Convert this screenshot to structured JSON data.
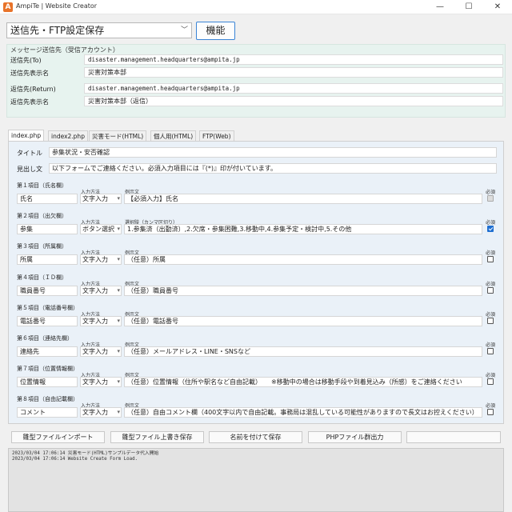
{
  "window": {
    "title": "AmpiTe | Website Creator",
    "app_icon": "A",
    "minimize": "—",
    "maximize": "☐",
    "close": "✕"
  },
  "toolbar": {
    "mode_value": "送信先・FTP設定保存",
    "function_label": "機能"
  },
  "message_panel": {
    "title": "メッセージ送信先（受信アカウント）",
    "rows": [
      {
        "label": "送信先(To)",
        "value": "disaster.management.headquarters@ampita.jp"
      },
      {
        "label": "送信先表示名",
        "value": "災害対策本部"
      },
      {
        "label": "返信先(Return)",
        "value": "disaster.management.headquarters@ampita.jp"
      },
      {
        "label": "返信先表示名",
        "value": "災害対策本部（返信）"
      }
    ]
  },
  "tabs": [
    "index.php",
    "index2.php",
    "災害モード(HTML)",
    "個人用(HTML)",
    "FTP(Web)"
  ],
  "form": {
    "title_label": "タイトル",
    "title_value": "参集状況・安否確認",
    "heading_label": "見出し文",
    "heading_value": "以下フォームでご連絡ください。必須入力項目には『(*)』印が付いています。",
    "col_input_method": "入力方法",
    "col_example": "例示文",
    "col_options": "選択肢（カンマ区切り）",
    "col_required": "必須",
    "items": [
      {
        "header": "第１項目（氏名欄）",
        "name": "氏名",
        "method": "文字入力",
        "example": "【必須入力】氏名",
        "required": false,
        "disabled": true
      },
      {
        "header": "第２項目（出欠欄）",
        "name": "参集",
        "method": "ボタン選択",
        "example": "1.参集済（出勤済）,2.欠席・参集困難,3.移動中,4.参集予定・検討中,5.その他",
        "required": true
      },
      {
        "header": "第３項目（所属欄）",
        "name": "所属",
        "method": "文字入力",
        "example": "（任意）所属",
        "required": false
      },
      {
        "header": "第４項目（ＩＤ欄）",
        "name": "職員番号",
        "method": "文字入力",
        "example": "（任意）職員番号",
        "required": false
      },
      {
        "header": "第５項目（電話番号欄）",
        "name": "電話番号",
        "method": "文字入力",
        "example": "（任意）電話番号",
        "required": false
      },
      {
        "header": "第６項目（連絡先欄）",
        "name": "連絡先",
        "method": "文字入力",
        "example": "（任意）メールアドレス・LINE・SNSなど",
        "required": false
      },
      {
        "header": "第７項目（位置情報欄）",
        "name": "位置情報",
        "method": "文字入力",
        "example": "（任意）位置情報（住所や駅名など自由記載）　　※移動中の場合は移動手段や到着見込み（所感）をご連絡ください",
        "required": false
      },
      {
        "header": "第８項目（自由記載欄）",
        "name": "コメント",
        "method": "文字入力",
        "example": "（任意）自由コメント欄（400文字以内で自由記載。事務局は混乱している可能性がありますので長文はお控えください）",
        "required": false
      }
    ]
  },
  "actions": {
    "import": "雛型ファイルインポート",
    "overwrite": "雛型ファイル上書き保存",
    "save_as": "名前を付けて保存",
    "php_output": "PHPファイル群出力"
  },
  "log": [
    "2023/03/04 17:06:14 災害モード(HTML)サンプルデータ代入開始",
    "2023/03/04 17:06:14 Website Create Form Load."
  ]
}
